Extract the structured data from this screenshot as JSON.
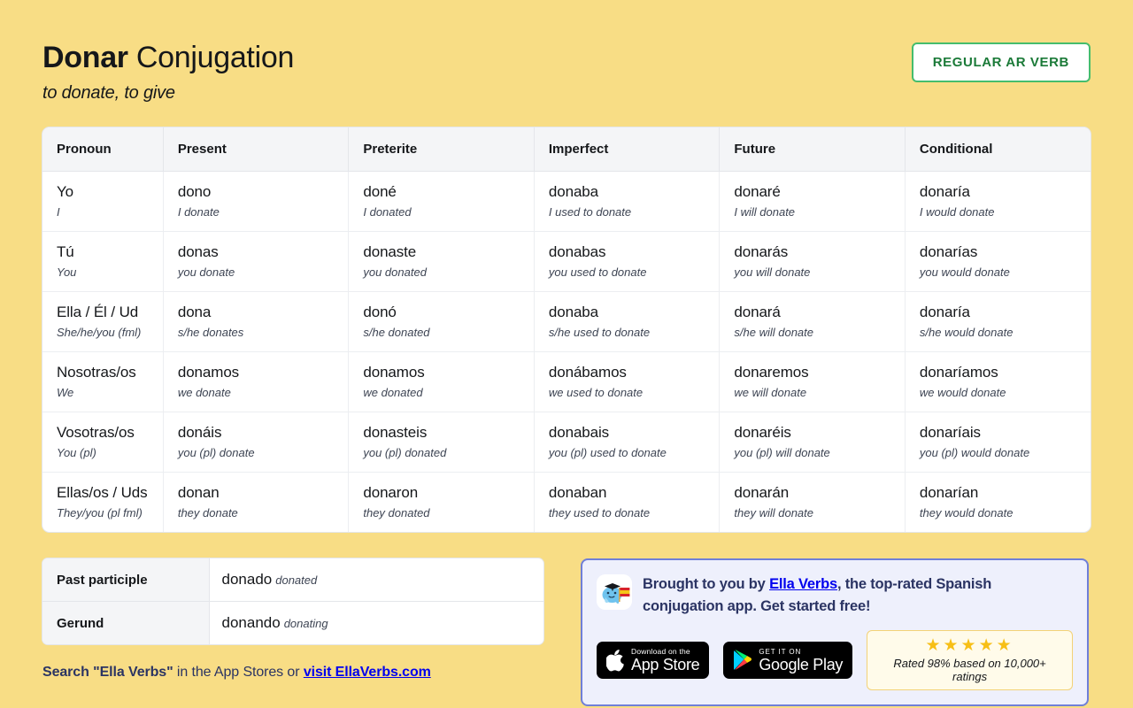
{
  "header": {
    "verb": "Donar",
    "title_suffix": " Conjugation",
    "subtitle": "to donate, to give",
    "badge": "REGULAR AR VERB"
  },
  "colors": {
    "background": "#f8dd85",
    "badge_border": "#45bd6d",
    "badge_text": "#1b7a38",
    "navy": "#2b3463",
    "promo_bg": "#eef0fc",
    "promo_border": "#6f7fd8",
    "star": "#f7bf16"
  },
  "table": {
    "headers": [
      "Pronoun",
      "Present",
      "Preterite",
      "Imperfect",
      "Future",
      "Conditional"
    ],
    "rows": [
      {
        "pronoun": "Yo",
        "pronoun_gloss": "I",
        "cells": [
          {
            "form": "dono",
            "gloss": "I donate"
          },
          {
            "form": "doné",
            "gloss": "I donated"
          },
          {
            "form": "donaba",
            "gloss": "I used to donate"
          },
          {
            "form": "donaré",
            "gloss": "I will donate"
          },
          {
            "form": "donaría",
            "gloss": "I would donate"
          }
        ]
      },
      {
        "pronoun": "Tú",
        "pronoun_gloss": "You",
        "cells": [
          {
            "form": "donas",
            "gloss": "you donate"
          },
          {
            "form": "donaste",
            "gloss": "you donated"
          },
          {
            "form": "donabas",
            "gloss": "you used to donate"
          },
          {
            "form": "donarás",
            "gloss": "you will donate"
          },
          {
            "form": "donarías",
            "gloss": "you would donate"
          }
        ]
      },
      {
        "pronoun": "Ella / Él / Ud",
        "pronoun_gloss": "She/he/you (fml)",
        "cells": [
          {
            "form": "dona",
            "gloss": "s/he donates"
          },
          {
            "form": "donó",
            "gloss": "s/he donated"
          },
          {
            "form": "donaba",
            "gloss": "s/he used to donate"
          },
          {
            "form": "donará",
            "gloss": "s/he will donate"
          },
          {
            "form": "donaría",
            "gloss": "s/he would donate"
          }
        ]
      },
      {
        "pronoun": "Nosotras/os",
        "pronoun_gloss": "We",
        "cells": [
          {
            "form": "donamos",
            "gloss": "we donate"
          },
          {
            "form": "donamos",
            "gloss": "we donated"
          },
          {
            "form": "donábamos",
            "gloss": "we used to donate"
          },
          {
            "form": "donaremos",
            "gloss": "we will donate"
          },
          {
            "form": "donaríamos",
            "gloss": "we would donate"
          }
        ]
      },
      {
        "pronoun": "Vosotras/os",
        "pronoun_gloss": "You (pl)",
        "cells": [
          {
            "form": "donáis",
            "gloss": "you (pl) donate"
          },
          {
            "form": "donasteis",
            "gloss": "you (pl) donated"
          },
          {
            "form": "donabais",
            "gloss": "you (pl) used to donate"
          },
          {
            "form": "donaréis",
            "gloss": "you (pl) will donate"
          },
          {
            "form": "donaríais",
            "gloss": "you (pl) would donate"
          }
        ]
      },
      {
        "pronoun": "Ellas/os / Uds",
        "pronoun_gloss": "They/you (pl fml)",
        "cells": [
          {
            "form": "donan",
            "gloss": "they donate"
          },
          {
            "form": "donaron",
            "gloss": "they donated"
          },
          {
            "form": "donaban",
            "gloss": "they used to donate"
          },
          {
            "form": "donarán",
            "gloss": "they will donate"
          },
          {
            "form": "donarían",
            "gloss": "they would donate"
          }
        ]
      }
    ]
  },
  "forms": {
    "participle_label": "Past participle",
    "participle_value": "donado",
    "participle_gloss": "donated",
    "gerund_label": "Gerund",
    "gerund_value": "donando",
    "gerund_gloss": "donating"
  },
  "search_line": {
    "part1": "Search \"Ella Verbs\"",
    "part2": " in the App Stores or ",
    "link": "visit EllaVerbs.com"
  },
  "promo": {
    "text_before": "Brought to you by ",
    "link": "Ella Verbs",
    "text_after": ", the top-rated Spanish conjugation app. Get started free!",
    "app_store": {
      "small": "Download on the",
      "big": "App Store"
    },
    "google_play": {
      "small": "GET IT ON",
      "big": "Google Play"
    },
    "stars": "★★★★★",
    "rating_text": "Rated 98% based on 10,000+ ratings"
  }
}
